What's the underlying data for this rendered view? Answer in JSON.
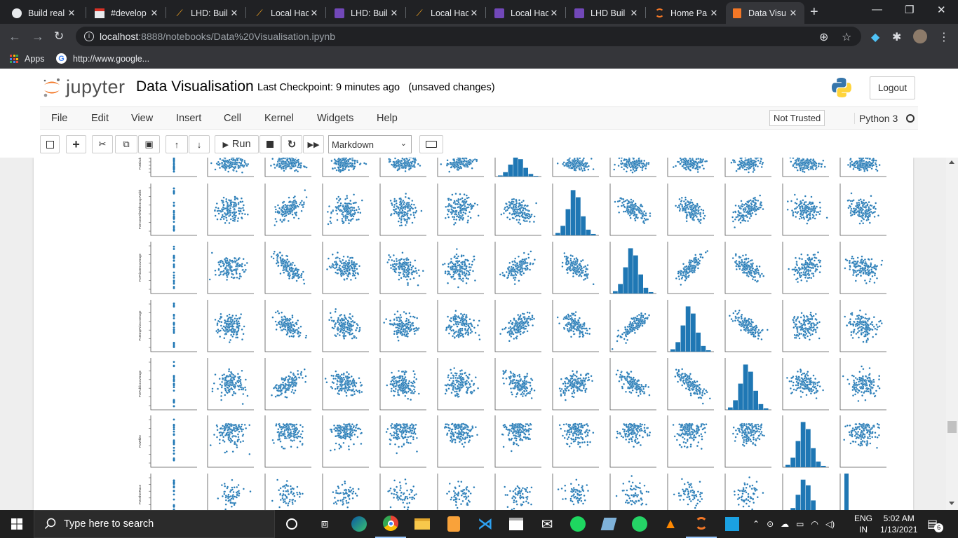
{
  "browser": {
    "tabs": [
      {
        "title": "Build real",
        "icon": "github-icon"
      },
      {
        "title": "#develop",
        "icon": "calendar-icon"
      },
      {
        "title": "LHD: Buil",
        "icon": "mlh-icon"
      },
      {
        "title": "Local Hac",
        "icon": "mlh-icon"
      },
      {
        "title": "LHD: Buil",
        "icon": "form-icon"
      },
      {
        "title": "Local Hac",
        "icon": "mlh-icon"
      },
      {
        "title": "Local Hac",
        "icon": "form-icon"
      },
      {
        "title": "LHD Buil",
        "icon": "form-icon"
      },
      {
        "title": "Home Pa",
        "icon": "jupyter-icon"
      },
      {
        "title": "Data Visu",
        "icon": "notebook-icon",
        "active": true
      }
    ],
    "url_host": "localhost",
    "url_path": ":8888/notebooks/Data%20Visualisation.ipynb",
    "bookmarks": [
      {
        "label": "Apps",
        "icon": "apps-grid-icon"
      },
      {
        "label": "http://www.google...",
        "icon": "google-icon"
      }
    ]
  },
  "jupyter": {
    "logo_text": "jupyter",
    "notebook_title": "Data Visualisation",
    "checkpoint": "Last Checkpoint: 9 minutes ago",
    "unsaved": "(unsaved changes)",
    "logout": "Logout",
    "menu": [
      "File",
      "Edit",
      "View",
      "Insert",
      "Cell",
      "Kernel",
      "Widgets",
      "Help"
    ],
    "trust": "Not Trusted",
    "kernel": "Python 3",
    "run_label": "Run",
    "cell_type": "Markdown"
  },
  "figure": {
    "row_labels": [
      "PctBlack",
      "PctHomeAllWithGroupAmbit",
      "PctPrivateCoverage",
      "PctEmpPrivCoverage",
      "PctPublicCoverage",
      "PctWhite",
      "PctOtherRace"
    ],
    "plot_color": "#1f77b4"
  },
  "taskbar": {
    "search_placeholder": "Type here to search",
    "language_top": "ENG",
    "language_bottom": "IN",
    "time": "5:02 AM",
    "date": "1/13/2021",
    "notifications": "6"
  }
}
